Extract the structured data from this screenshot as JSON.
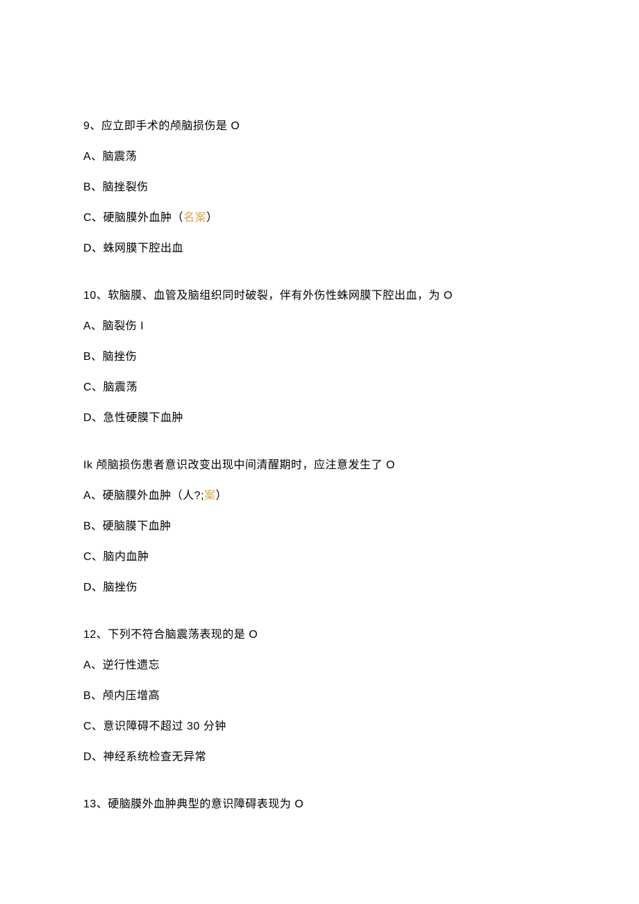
{
  "q9": {
    "stem": "9、应立即手术的颅脑损伤是 O",
    "a": "A、脑震荡",
    "b": "B、脑挫裂伤",
    "c_prefix": "C、硬脑膜外血肿（",
    "c_answer": "名案",
    "c_suffix": "）",
    "d": "D、蛛网膜下腔出血"
  },
  "q10": {
    "stem": "10、软脑膜、血管及脑组织同时破裂，伴有外伤性蛛网膜下腔出血，为 O",
    "a": "A、脑裂伤 I",
    "b": "B、脑挫伤",
    "c": "C、脑震荡",
    "d": "D、急性硬膜下血肿"
  },
  "q11": {
    "stem": "Ik 颅脑损伤患者意识改变出现中间清醒期时，应注意发生了 O",
    "a_prefix": "A、硬脑膜外血肿（人?;",
    "a_answer": "案",
    "a_suffix": "）",
    "b": "B、硬脑膜下血肿",
    "c": "C、脑内血肿",
    "d": "D、脑挫伤"
  },
  "q12": {
    "stem": "12、下列不符合脑震荡表现的是 O",
    "a": "A、逆行性遗忘",
    "b": "B、颅内压增高",
    "c": "C、意识障碍不超过 30 分钟",
    "d": "D、神经系统检查无异常"
  },
  "q13": {
    "stem": "13、硬脑膜外血肿典型的意识障碍表现为 O"
  }
}
